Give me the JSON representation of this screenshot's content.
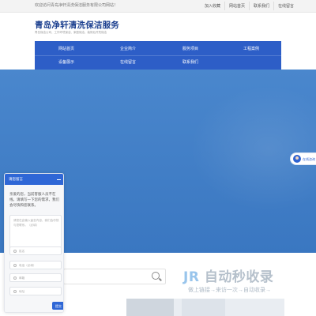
{
  "topbar": {
    "welcome": "欢迎访问青岛净轩清洗保洁服务有限公司网站！",
    "links": [
      "加入收藏",
      "网站首页",
      "联系我们",
      "在线留言"
    ]
  },
  "logo": {
    "title": "青岛净轩清洗保洁服务",
    "subtitle": "青岛保洁公司、工作环境保洁、家庭保洁、装修后开荒保洁"
  },
  "nav": {
    "row1": [
      "网站首页",
      "企业简介",
      "服务项目",
      "工程案例"
    ],
    "row2": [
      "设备展示",
      "在线留言",
      "联系我们"
    ]
  },
  "service_tab": {
    "label": "在线咨询"
  },
  "chat": {
    "title": "请您留言",
    "intro": "亲爱的您，当前客服人员不在线，请填写一下您的需求，我们会尽快和您联系。",
    "message_placeholder": "请您在此输入留言内容，我们会尽快与您联系。（必填）",
    "fields": [
      {
        "placeholder": "姓名",
        "icon": "user-icon"
      },
      {
        "placeholder": "电话（必填）",
        "icon": "phone-icon"
      },
      {
        "placeholder": "邮箱",
        "icon": "mail-icon"
      },
      {
        "placeholder": "地址",
        "icon": "location-icon"
      }
    ],
    "submit": "提交"
  },
  "watermark": {
    "main": "自动秒收录",
    "sub": "做上链接→来访一次→自动收录→"
  },
  "colors": {
    "brand": "#1b3f8f",
    "nav": "#2d5ec7",
    "banner": "#3f7fc9",
    "chat_header": "#2f67d6"
  }
}
